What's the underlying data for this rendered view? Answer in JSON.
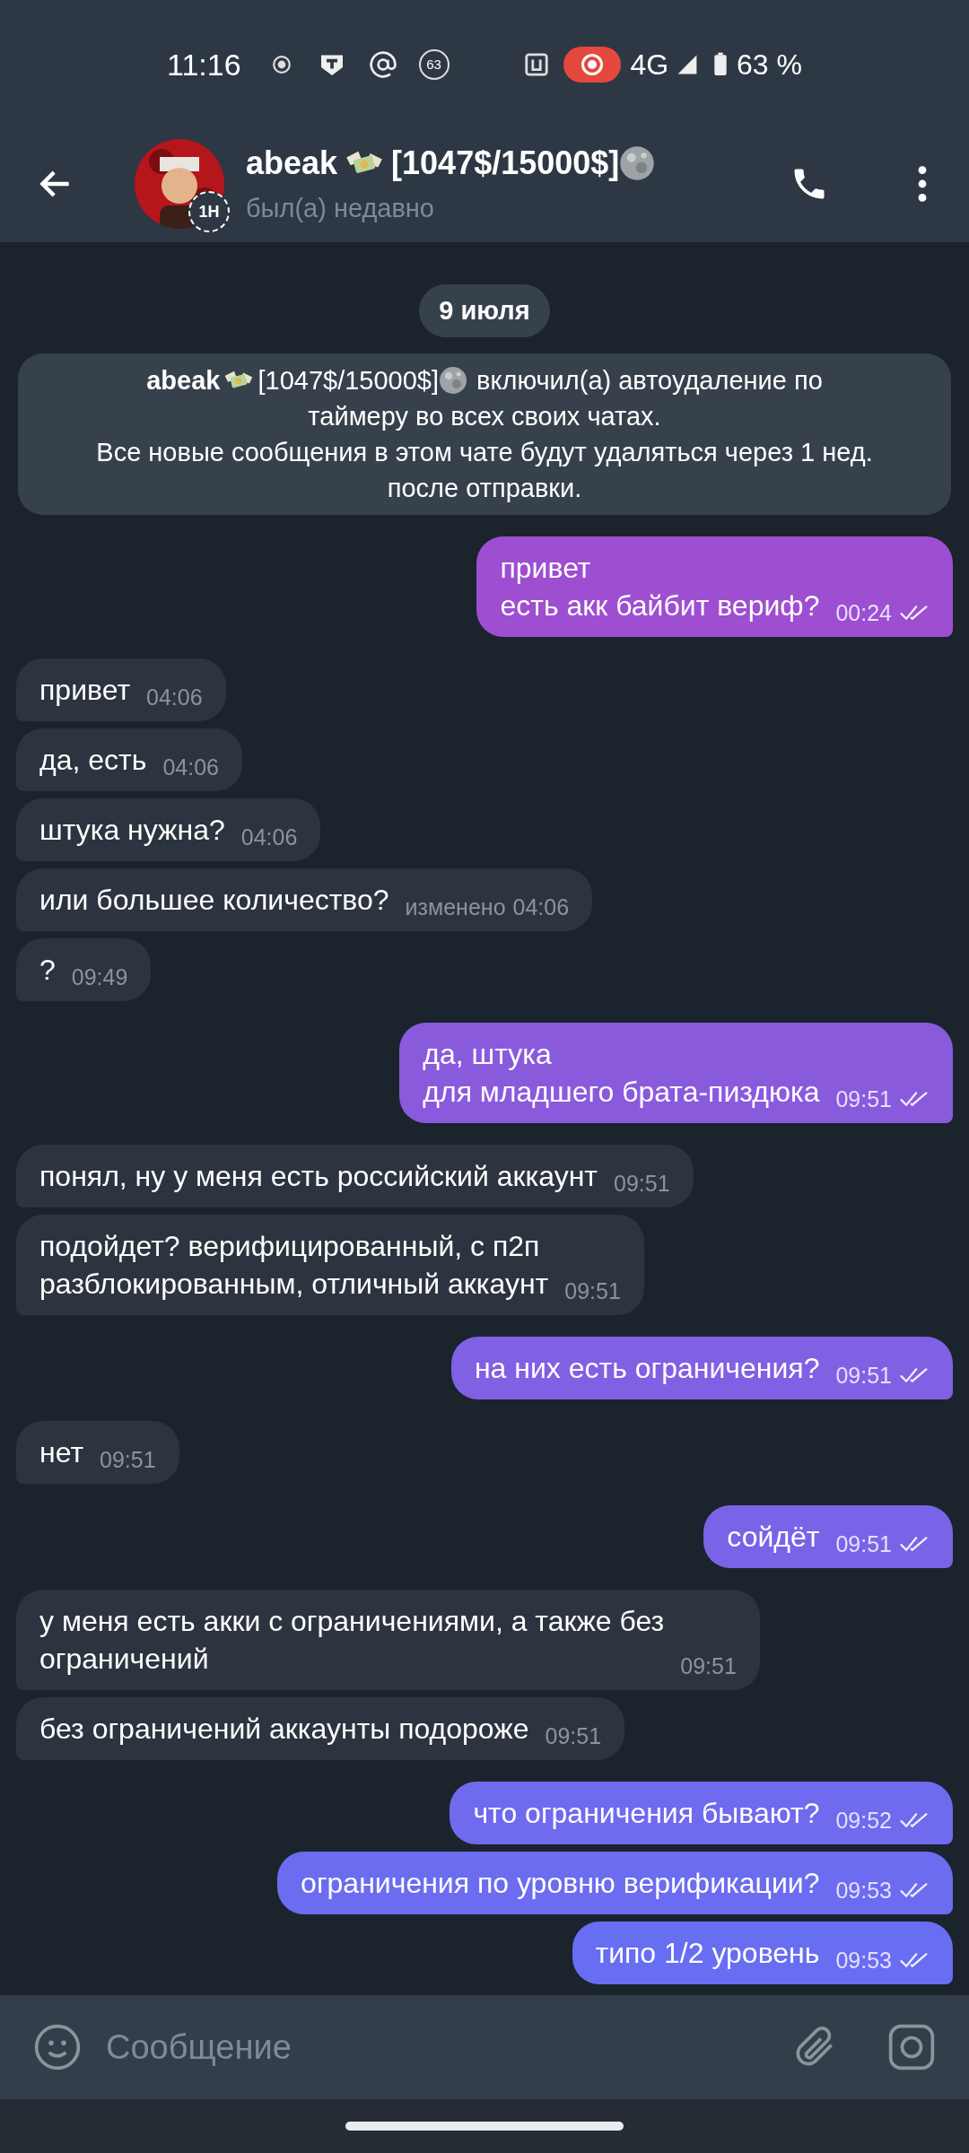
{
  "status_bar": {
    "time": "11:16",
    "notification_count": "63",
    "network": "4G",
    "battery": "63 %"
  },
  "header": {
    "name": "abeak",
    "amount": "[1047$/15000$]",
    "avatar_badge": "1Н",
    "subtitle": "был(а) недавно"
  },
  "date": "9 июля",
  "service": {
    "name": "abeak",
    "amount": "[1047$/15000$]",
    "action_lines": [
      "включил(а) автоудаление по",
      "таймеру во всех своих чатах."
    ],
    "note_lines": [
      "Все новые сообщения в этом чате будут удаляться через 1 нед.",
      "после отправки."
    ]
  },
  "messages": [
    {
      "kind": "outgoing",
      "lines": [
        "привет",
        "есть акк байбит вериф?"
      ],
      "time": "00:24",
      "read": true
    },
    {
      "kind": "incoming",
      "lines": [
        "привет"
      ],
      "time": "04:06"
    },
    {
      "kind": "incoming",
      "lines": [
        "да, есть"
      ],
      "time": "04:06"
    },
    {
      "kind": "incoming",
      "lines": [
        "штука нужна?"
      ],
      "time": "04:06"
    },
    {
      "kind": "incoming",
      "lines": [
        "или большее количество?"
      ],
      "edited": "изменено",
      "time": "04:06"
    },
    {
      "kind": "incoming",
      "lines": [
        "?"
      ],
      "time": "09:49"
    },
    {
      "kind": "outgoing",
      "lines": [
        "да, штука",
        "для младшего брата-пиздюка"
      ],
      "time": "09:51",
      "read": true
    },
    {
      "kind": "incoming",
      "lines": [
        "понял, ну у меня есть российский аккаунт"
      ],
      "time": "09:51"
    },
    {
      "kind": "incoming",
      "lines": [
        "подойдет? верифицированный, с п2п",
        "разблокированным, отличный аккаунт"
      ],
      "time": "09:51"
    },
    {
      "kind": "outgoing",
      "lines": [
        "на них есть ограничения?"
      ],
      "time": "09:51",
      "read": true
    },
    {
      "kind": "incoming",
      "lines": [
        "нет"
      ],
      "time": "09:51"
    },
    {
      "kind": "outgoing",
      "lines": [
        "сойдёт"
      ],
      "time": "09:51",
      "read": true
    },
    {
      "kind": "incoming",
      "lines": [
        "у меня есть акки с ограничениями, а также без",
        "ограничений"
      ],
      "time": "09:51"
    },
    {
      "kind": "incoming",
      "lines": [
        "без ограничений аккаунты подороже"
      ],
      "time": "09:51"
    },
    {
      "kind": "outgoing",
      "lines": [
        "что ограничения бывают?"
      ],
      "time": "09:52",
      "read": true
    },
    {
      "kind": "outgoing",
      "lines": [
        "ограничения по уровню верификации?"
      ],
      "time": "09:53",
      "read": true
    },
    {
      "kind": "outgoing",
      "lines": [
        "типо 1/2 уровень"
      ],
      "time": "09:53",
      "read": true
    }
  ],
  "composer": {
    "placeholder": "Сообщение"
  }
}
